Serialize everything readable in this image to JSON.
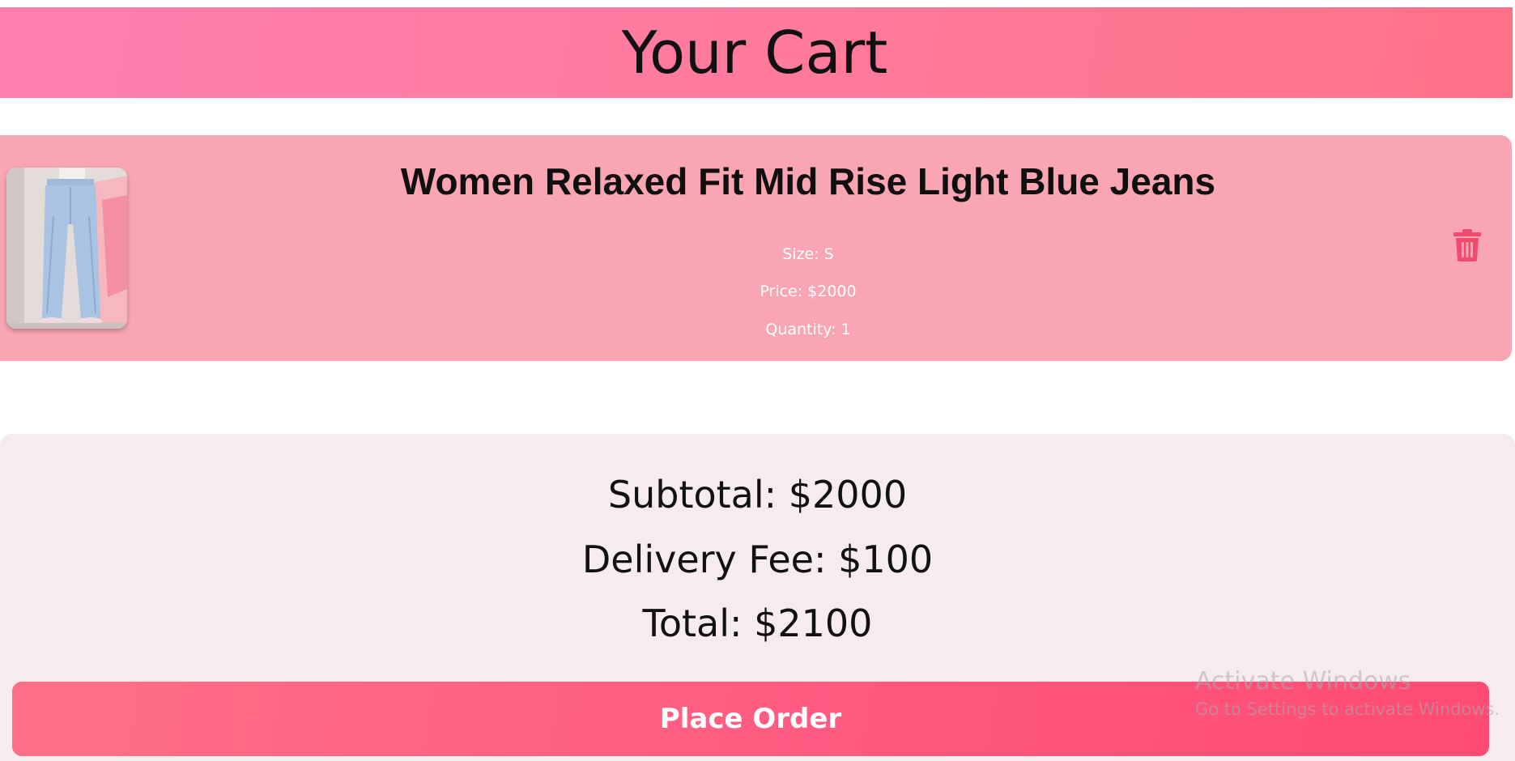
{
  "header": {
    "title": "Your Cart"
  },
  "cart": {
    "items": [
      {
        "name": "Women Relaxed Fit Mid Rise Light Blue Jeans",
        "size": "Size: S",
        "price": "Price: $2000",
        "quantity": "Quantity: 1",
        "thumbnail_icon": "jeans-product-photo",
        "delete_icon": "trash-icon"
      }
    ]
  },
  "summary": {
    "subtotal": "Subtotal: $2000",
    "delivery_fee": "Delivery Fee: $100",
    "total": "Total: $2100",
    "place_order_label": "Place Order"
  },
  "os_watermark": {
    "title": "Activate Windows",
    "subtitle": "Go to Settings to activate Windows."
  },
  "colors": {
    "header_gradient": [
      "#ff7eb0",
      "#ff7188"
    ],
    "item_background": "#f9a5b4",
    "summary_background": "#f6ecee",
    "button_gradient": [
      "#ff7087",
      "#ff4b74"
    ],
    "trash_icon": "#f24b6f"
  }
}
